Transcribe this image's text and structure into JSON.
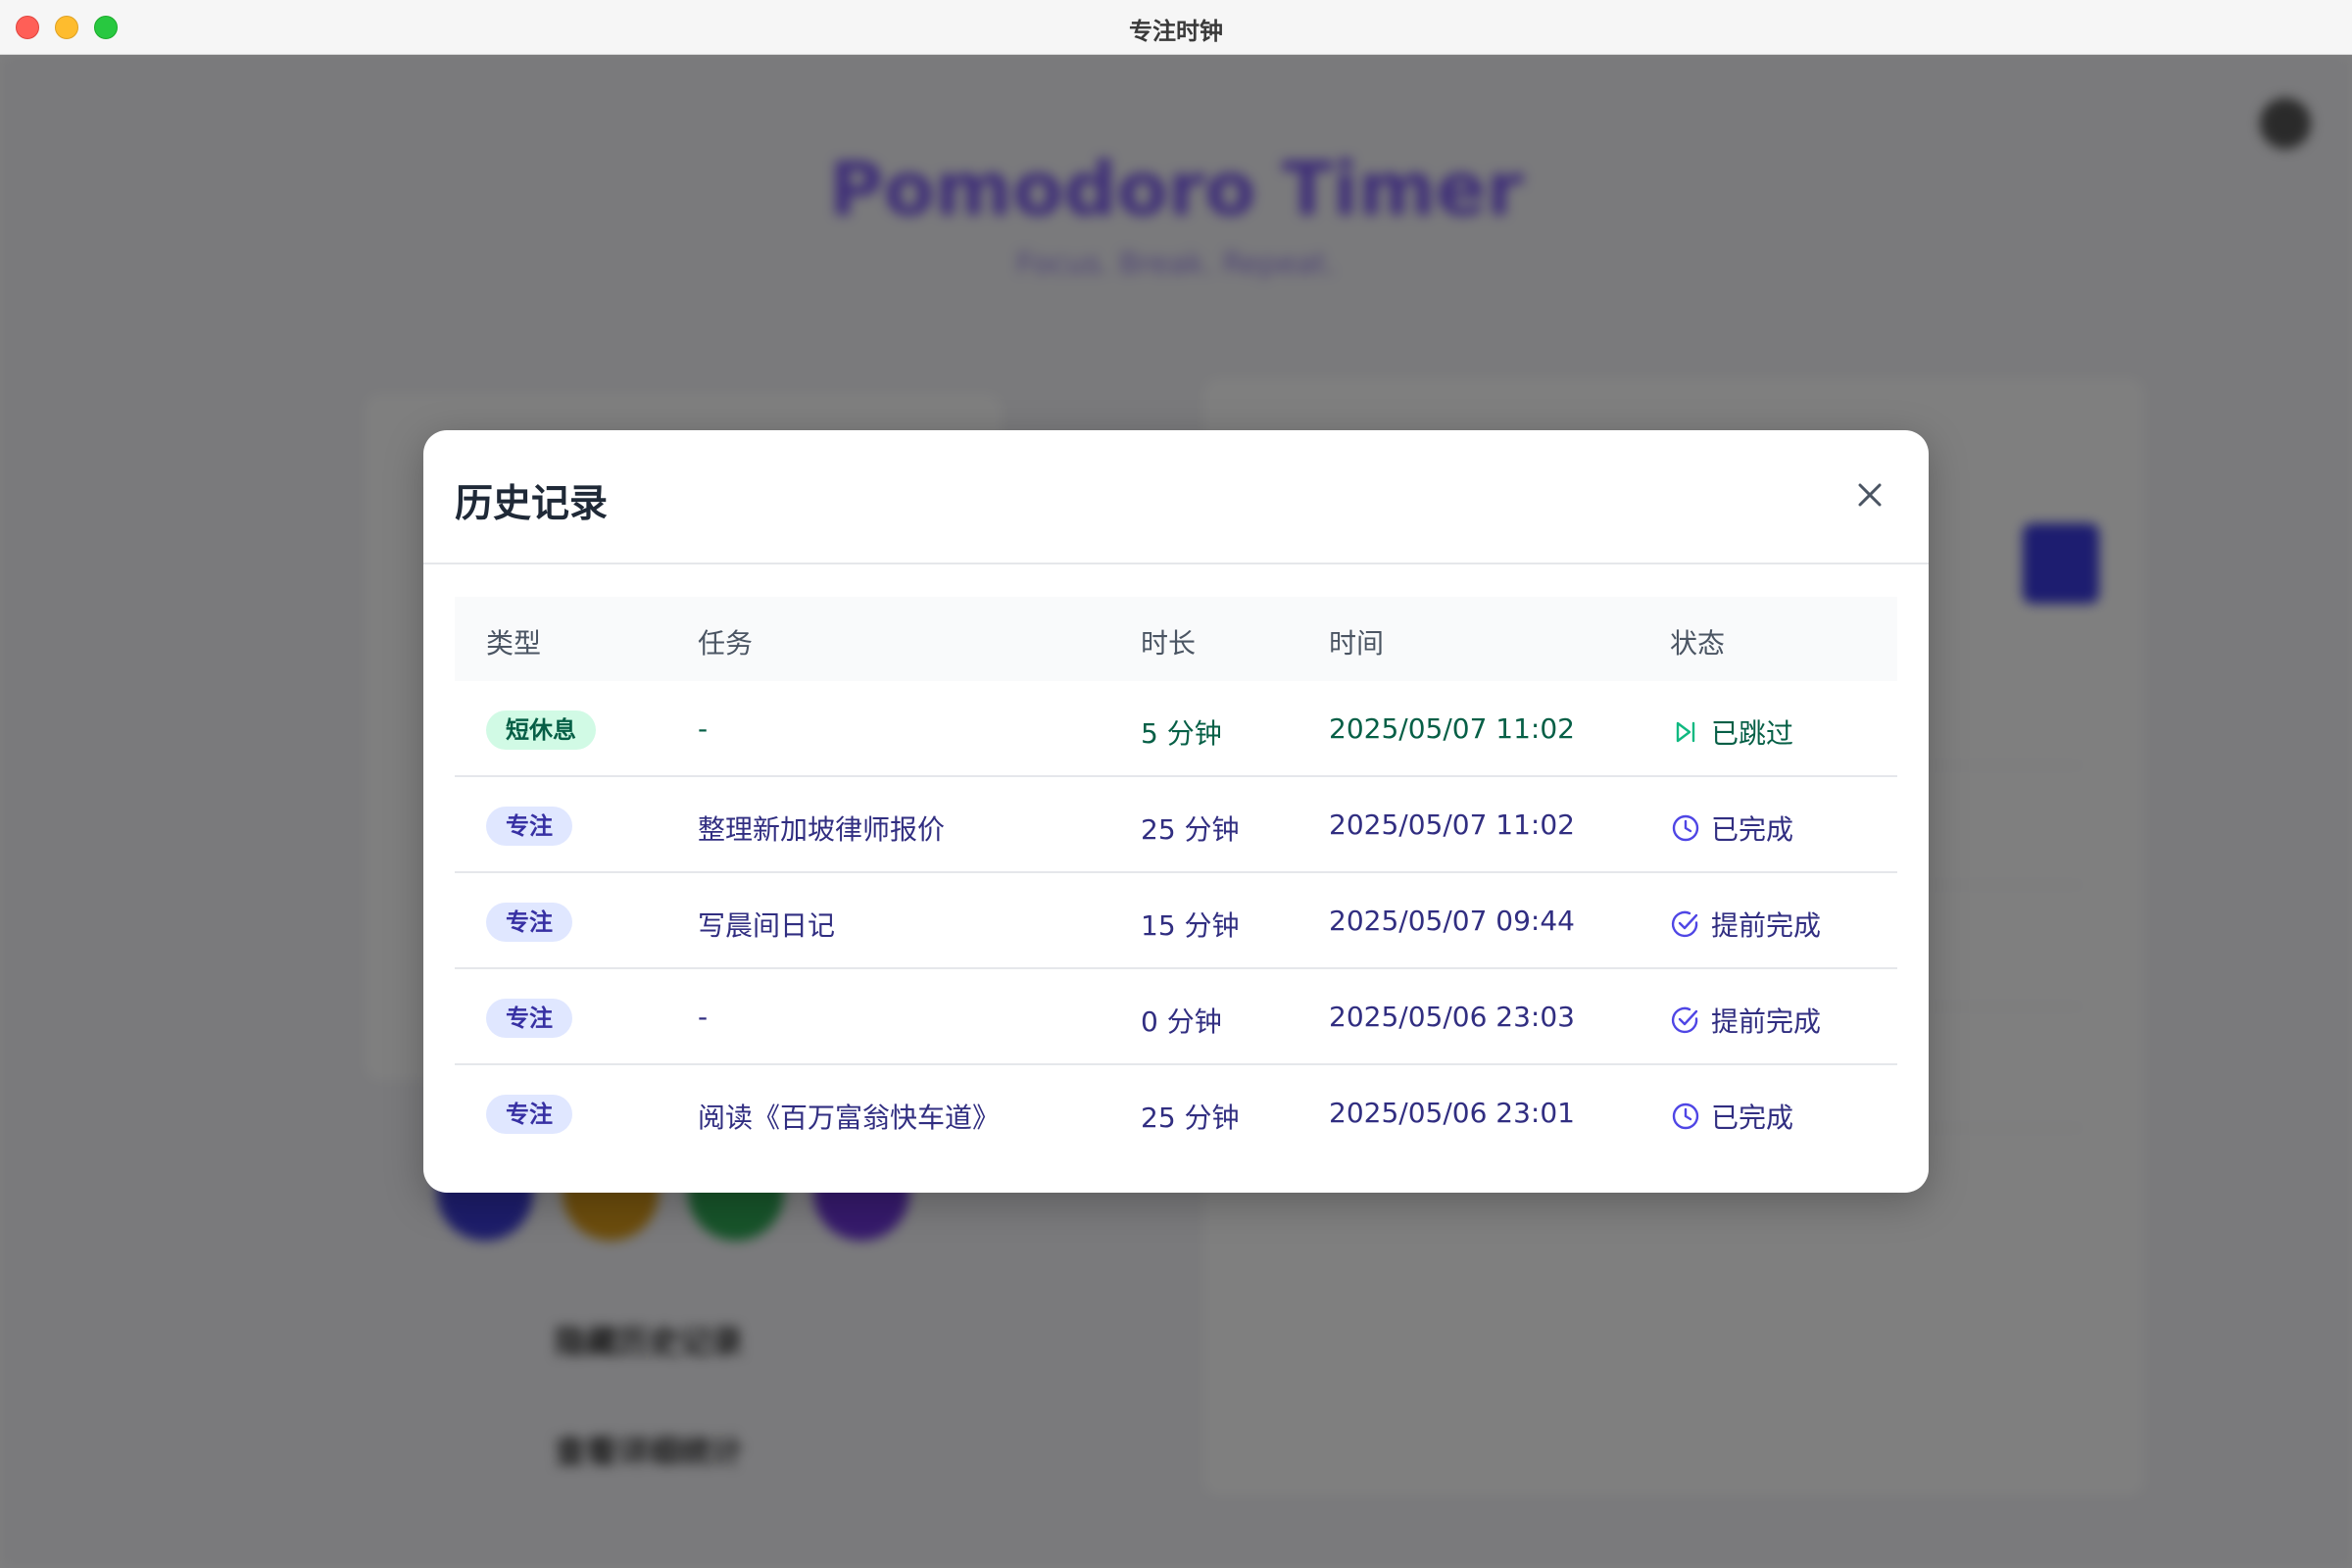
{
  "window": {
    "title": "专注时钟"
  },
  "background": {
    "app_title": "Pomodoro Timer",
    "app_subtitle": "Focus. Break. Repeat.",
    "links": [
      "隐藏历史记录",
      "查看详细统计"
    ]
  },
  "modal": {
    "title": "历史记录",
    "close_icon": "close-icon",
    "columns": [
      "类型",
      "任务",
      "时长",
      "时间",
      "状态"
    ],
    "rows": [
      {
        "type": "短休息",
        "kind": "break",
        "task": "-",
        "duration": "5 分钟",
        "time": "2025/05/07 11:02",
        "status": "已跳过",
        "status_icon": "skip-forward-icon"
      },
      {
        "type": "专注",
        "kind": "focus",
        "task": "整理新加坡律师报价",
        "duration": "25 分钟",
        "time": "2025/05/07 11:02",
        "status": "已完成",
        "status_icon": "clock-icon"
      },
      {
        "type": "专注",
        "kind": "focus",
        "task": "写晨间日记",
        "duration": "15 分钟",
        "time": "2025/05/07 09:44",
        "status": "提前完成",
        "status_icon": "check-circle-icon"
      },
      {
        "type": "专注",
        "kind": "focus",
        "task": "-",
        "duration": "0 分钟",
        "time": "2025/05/06 23:03",
        "status": "提前完成",
        "status_icon": "check-circle-icon"
      },
      {
        "type": "专注",
        "kind": "focus",
        "task": "阅读《百万富翁快车道》",
        "duration": "25 分钟",
        "time": "2025/05/06 23:01",
        "status": "已完成",
        "status_icon": "clock-icon"
      }
    ]
  },
  "colors": {
    "break_badge_bg": "#d1fae5",
    "focus_badge_bg": "#e0e7ff",
    "break_text": "#065f46",
    "focus_text": "#312e81",
    "accent": "#4f46e5"
  }
}
